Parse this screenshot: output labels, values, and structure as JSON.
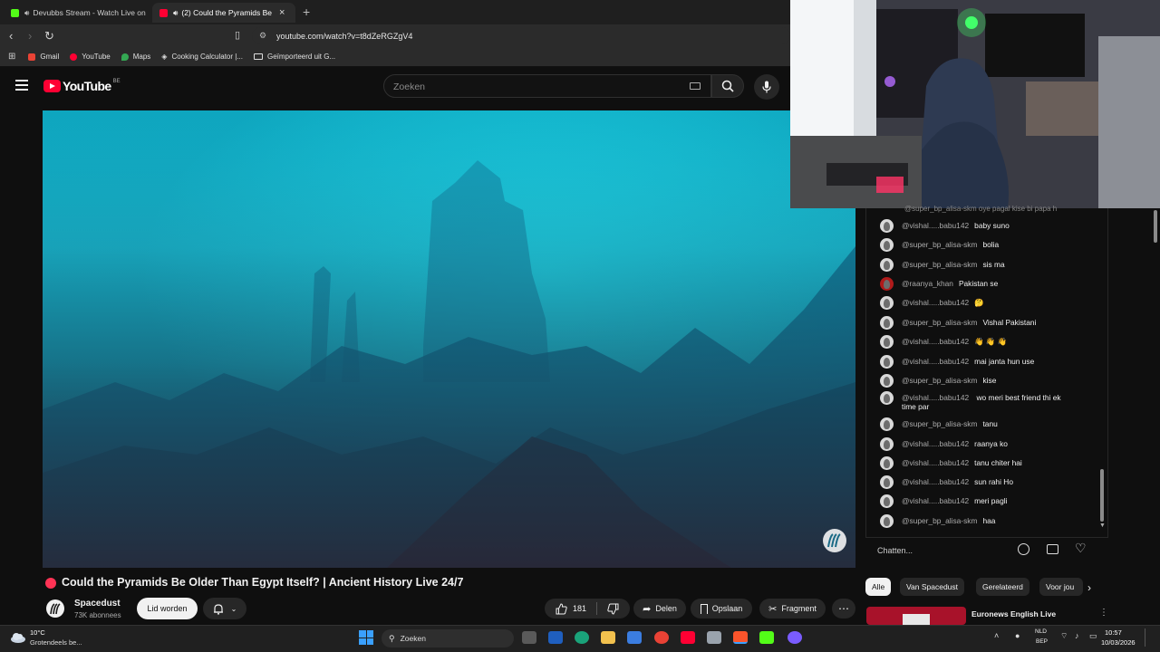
{
  "browser": {
    "tabs": [
      {
        "label": "Devubbs Stream - Watch Live on",
        "favicon_color": "#53fc18",
        "active": false
      },
      {
        "label": "(2)  Could the Pyramids Be",
        "favicon_color": "#ff0033",
        "active": true
      }
    ],
    "tab_close": "×",
    "new_tab": "+",
    "url": "youtube.com/watch?v=t8dZeRGZgV4",
    "bookmarks": [
      {
        "label": "Gmail",
        "color": "#ea4335"
      },
      {
        "label": "YouTube",
        "color": "#ff0033"
      },
      {
        "label": "Maps",
        "color": "#34a853"
      },
      {
        "label": "Cooking Calculator |...",
        "color": "#e0e0e0"
      },
      {
        "label": "Geïmporteerd uit G...",
        "color": "#e8e8e8"
      }
    ]
  },
  "youtube": {
    "logo_text": "YouTube",
    "country_code": "BE",
    "search_placeholder": "Zoeken"
  },
  "video": {
    "title": "Could the Pyramids Be Older Than Egypt Itself? | Ancient History Live 24/7",
    "channel": "Spacedust",
    "subscribers": "73K abonnees",
    "join_label": "Lid worden",
    "likes": "181",
    "share_label": "Delen",
    "save_label": "Opslaan",
    "clip_label": "Fragment",
    "more_label": "⋯"
  },
  "chat": {
    "messages": [
      {
        "author": "@vishal.....babu142",
        "text": "baby suno",
        "avatar": "gray"
      },
      {
        "author": "@super_bp_alisa-skm",
        "text": "bolia",
        "avatar": "gray"
      },
      {
        "author": "@super_bp_alisa-skm",
        "text": "sis ma",
        "avatar": "gray"
      },
      {
        "author": "@raanya_khan",
        "text": "Pakistan se",
        "avatar": "red"
      },
      {
        "author": "@vishal.....babu142",
        "text": "🤔",
        "avatar": "gray"
      },
      {
        "author": "@super_bp_alisa-skm",
        "text": "Vishal Pakistani",
        "avatar": "gray"
      },
      {
        "author": "@vishal.....babu142",
        "text": "👋 👋 👋",
        "avatar": "gray"
      },
      {
        "author": "@vishal.....babu142",
        "text": "mai janta hun use",
        "avatar": "gray"
      },
      {
        "author": "@super_bp_alisa-skm",
        "text": "kise",
        "avatar": "gray"
      },
      {
        "author": "@vishal.....babu142",
        "text": "wo meri best friend thi ek time par",
        "avatar": "gray"
      },
      {
        "author": "@super_bp_alisa-skm",
        "text": "tanu",
        "avatar": "gray"
      },
      {
        "author": "@vishal.....babu142",
        "text": "raanya ko",
        "avatar": "gray"
      },
      {
        "author": "@vishal.....babu142",
        "text": "tanu chiter hai",
        "avatar": "gray"
      },
      {
        "author": "@vishal.....babu142",
        "text": "sun rahi Ho",
        "avatar": "gray"
      },
      {
        "author": "@vishal.....babu142",
        "text": "meri pagli",
        "avatar": "gray"
      },
      {
        "author": "@super_bp_alisa-skm",
        "text": "haa",
        "avatar": "gray"
      }
    ],
    "input_placeholder": "Chatten..."
  },
  "chips": [
    "Alle",
    "Van Spacedust",
    "Gerelateerd",
    "Voor jou"
  ],
  "recommended": {
    "title": "Euronews English Live"
  },
  "taskbar": {
    "weather_temp": "10°C",
    "weather_desc": "Grotendeels be...",
    "search_label": "Zoeken",
    "lang_top": "NLD",
    "lang_bottom": "BEP",
    "time": "10:57",
    "date": "10/03/2026"
  },
  "colors": {
    "youtube_red": "#ff0033",
    "live_red": "#ff3355",
    "accent_blue": "#3aa0ff"
  }
}
